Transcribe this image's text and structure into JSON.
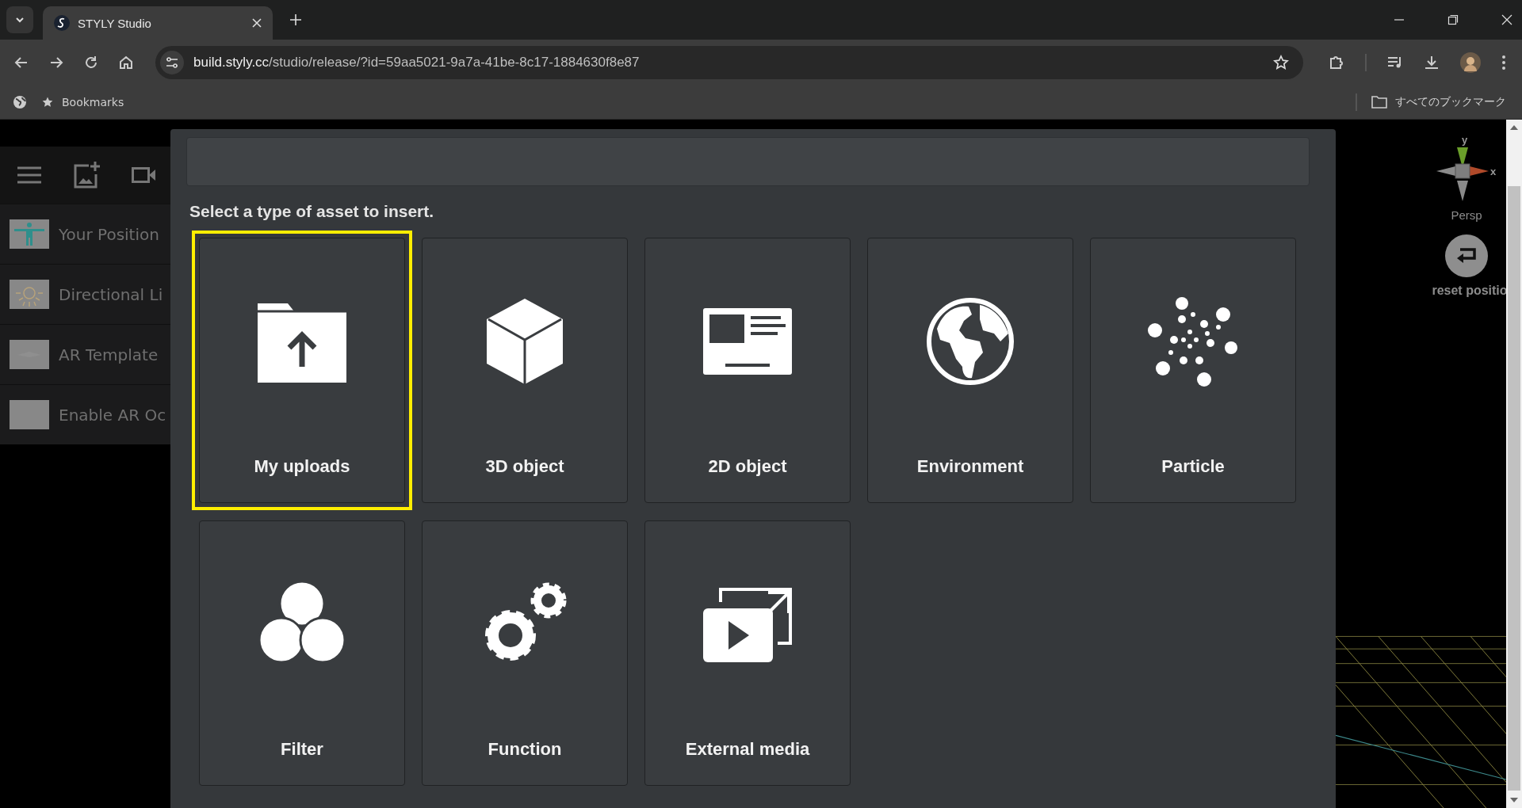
{
  "browser": {
    "tab_title": "STYLY Studio",
    "url_host": "build.styly.cc",
    "url_path": "/studio/release/?id=59aa5021-9a7a-41be-8c17-1884630f8e87",
    "bookmarks_label": "Bookmarks",
    "all_bookmarks_label": "すべてのブックマーク"
  },
  "sidebar": {
    "items": [
      {
        "label": "Your Position",
        "kind": "person"
      },
      {
        "label": "Directional Li",
        "kind": "bulb"
      },
      {
        "label": "AR Template",
        "kind": "plane"
      },
      {
        "label": "Enable AR Oc",
        "kind": "blank"
      }
    ]
  },
  "modal": {
    "heading": "Select a type of asset to insert.",
    "tiles": [
      {
        "label": "My uploads",
        "kind": "upload",
        "selected": true
      },
      {
        "label": "3D object",
        "kind": "cube",
        "selected": false
      },
      {
        "label": "2D object",
        "kind": "card",
        "selected": false
      },
      {
        "label": "Environment",
        "kind": "globe",
        "selected": false
      },
      {
        "label": "Particle",
        "kind": "particle",
        "selected": false
      },
      {
        "label": "Filter",
        "kind": "filter",
        "selected": false
      },
      {
        "label": "Function",
        "kind": "gears",
        "selected": false
      },
      {
        "label": "External media",
        "kind": "media",
        "selected": false
      }
    ]
  },
  "viewport": {
    "axis_y": "y",
    "axis_x": "x",
    "view_label": "Persp",
    "reset_label": "reset positio"
  }
}
